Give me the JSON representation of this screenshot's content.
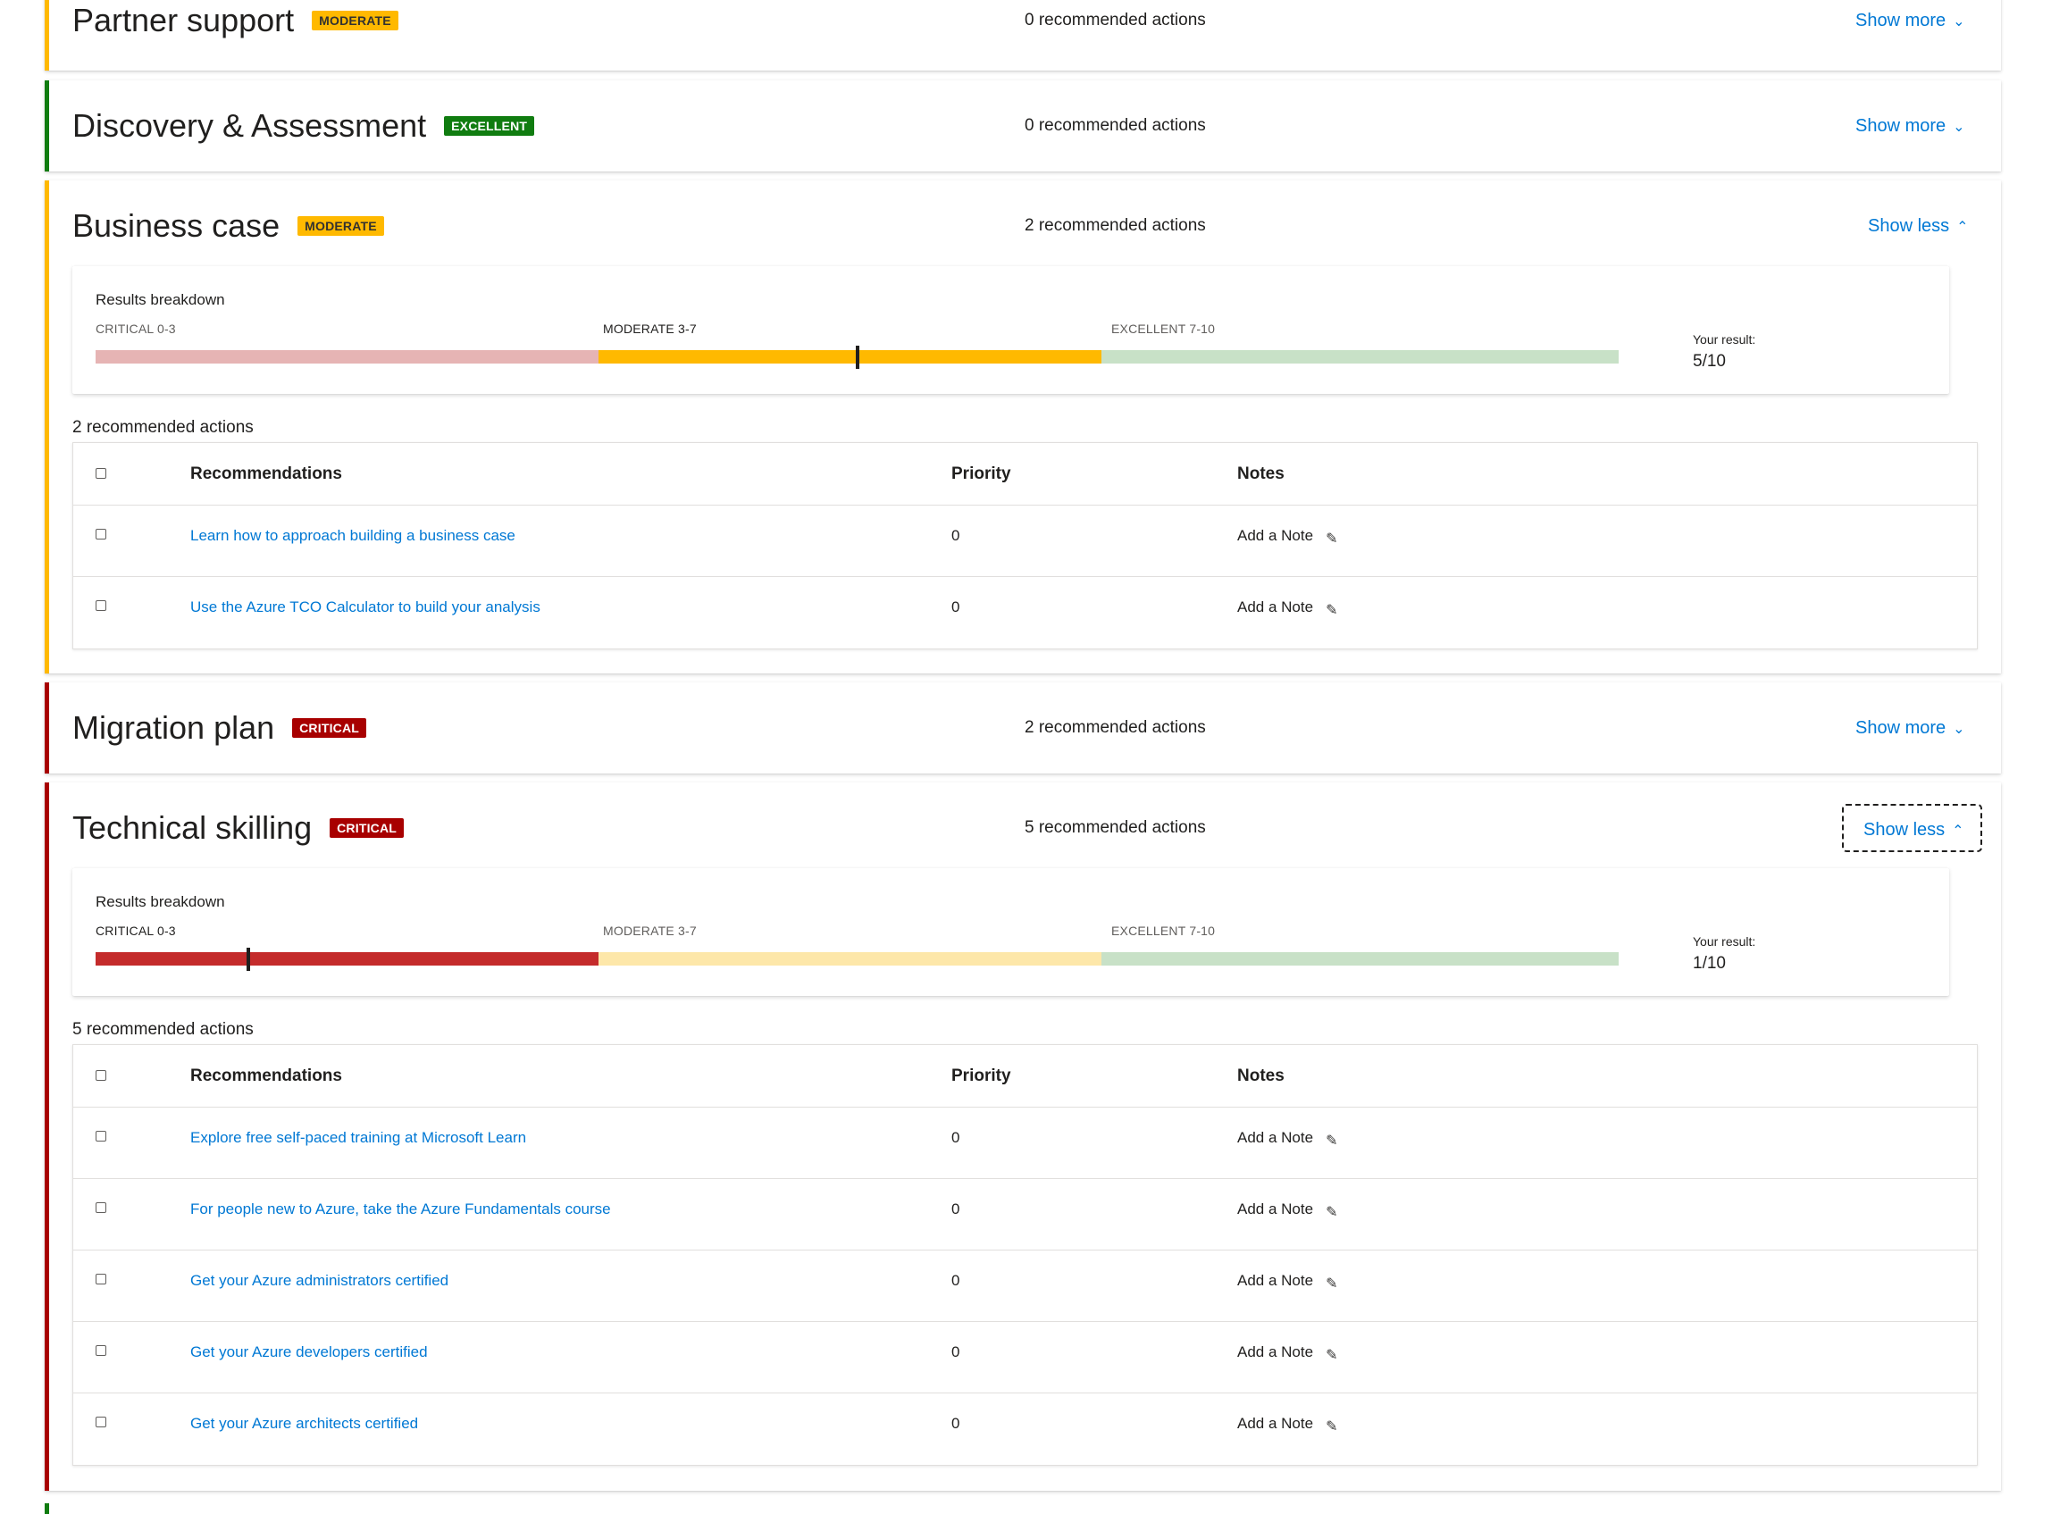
{
  "colors": {
    "moderate": "#ffb900",
    "excellent": "#107c10",
    "critical": "#a80000",
    "link": "#0078d4",
    "critical_light": "#e6b4b4",
    "moderate_light": "#fde7a9",
    "excellent_light": "#c8e1c7"
  },
  "breakdown_labels": {
    "title": "Results breakdown",
    "critical": "CRITICAL 0-3",
    "moderate": "MODERATE 3-7",
    "excellent": "EXCELLENT 7-10",
    "your_result": "Your result:"
  },
  "table_headers": {
    "recommendations": "Recommendations",
    "priority": "Priority",
    "notes": "Notes"
  },
  "add_note_label": "Add a Note",
  "icons": {
    "note": "pencil-icon",
    "expand": "chevron-down-icon",
    "collapse": "chevron-up-icon"
  },
  "sections": [
    {
      "title": "Partner support",
      "badge": "MODERATE",
      "recommended_actions": "0 recommended actions",
      "toggle": "Show more"
    },
    {
      "title": "Discovery & Assessment",
      "badge": "EXCELLENT",
      "recommended_actions": "0 recommended actions",
      "toggle": "Show more"
    },
    {
      "title": "Business case",
      "badge": "MODERATE",
      "recommended_actions": "2 recommended actions",
      "toggle": "Show less",
      "result_value": "5/10",
      "result_score": 5,
      "actions_count": "2 recommended actions",
      "recommendations": [
        {
          "text": "Learn how to approach building a business case",
          "priority": "0"
        },
        {
          "text": "Use the Azure TCO Calculator to build your analysis",
          "priority": "0"
        }
      ]
    },
    {
      "title": "Migration plan",
      "badge": "CRITICAL",
      "recommended_actions": "2 recommended actions",
      "toggle": "Show more"
    },
    {
      "title": "Technical skilling",
      "badge": "CRITICAL",
      "recommended_actions": "5 recommended actions",
      "toggle": "Show less",
      "result_value": "1/10",
      "result_score": 1,
      "actions_count": "5 recommended actions",
      "recommendations": [
        {
          "text": "Explore free self-paced training at Microsoft Learn",
          "priority": "0"
        },
        {
          "text": "For people new to Azure, take the Azure Fundamentals course",
          "priority": "0"
        },
        {
          "text": "Get your Azure administrators certified",
          "priority": "0"
        },
        {
          "text": "Get your Azure developers certified",
          "priority": "0"
        },
        {
          "text": "Get your Azure architects certified",
          "priority": "0"
        }
      ]
    }
  ]
}
